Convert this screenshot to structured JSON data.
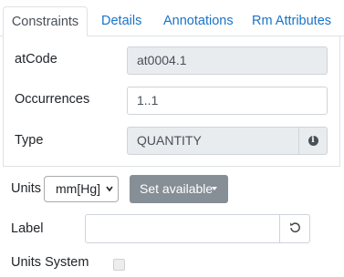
{
  "tabs": [
    "Constraints",
    "Details",
    "Annotations",
    "Rm Attributes"
  ],
  "active_tab": "Constraints",
  "form": {
    "atcode": {
      "label": "atCode",
      "value": "at0004.1"
    },
    "occurrences": {
      "label": "Occurrences",
      "value": "1..1"
    },
    "type": {
      "label": "Type",
      "value": "QUANTITY",
      "addon_icon": "info-icon"
    },
    "units": {
      "label": "Units",
      "selected": "mm[Hg]",
      "button_label": "Set available"
    },
    "label_field": {
      "label": "Label",
      "value": "",
      "button_icon": "reset-icon"
    },
    "units_system": {
      "label": "Units System",
      "checked": false
    }
  }
}
